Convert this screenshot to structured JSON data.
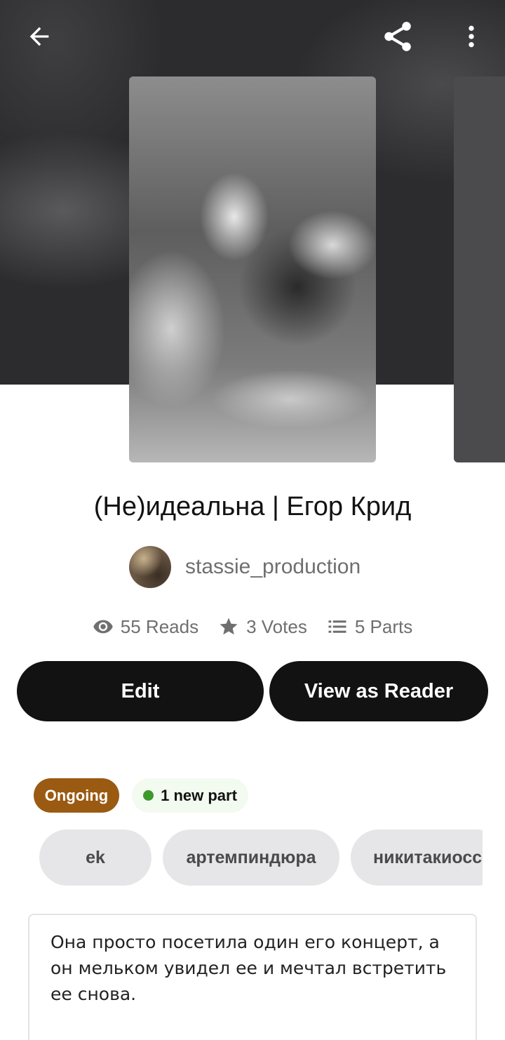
{
  "topbar": {
    "back_icon": "arrow-left-icon",
    "share_icon": "share-icon",
    "more_icon": "more-vertical-icon"
  },
  "story": {
    "title": "(Не)идеальна | Егор Крид",
    "author": "stassie_production",
    "stats": {
      "reads": "55 Reads",
      "votes": "3 Votes",
      "parts": "5 Parts"
    }
  },
  "actions": {
    "edit_label": "Edit",
    "view_as_reader_label": "View as Reader"
  },
  "status": {
    "ongoing_label": "Ongoing",
    "new_part_label": "1 new part",
    "ongoing_color": "#9a5a12",
    "new_part_dot_color": "#3c9a2c"
  },
  "tags": [
    "ek",
    "артемпиндюра",
    "никитакиосс"
  ],
  "description": "Она просто посетила один его концерт, а он мельком увидел ее и мечтал встретить ее снова."
}
